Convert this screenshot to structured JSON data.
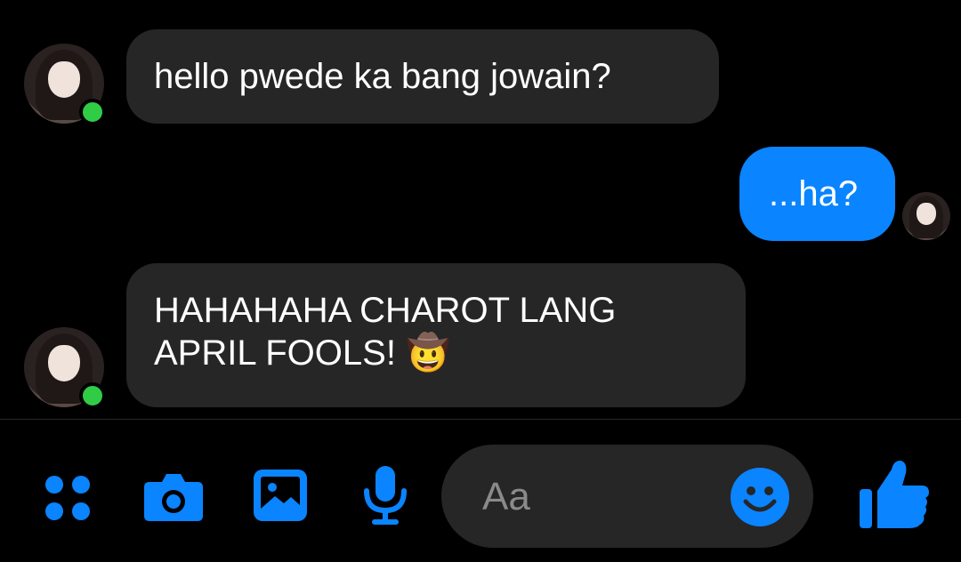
{
  "messages": [
    {
      "direction": "incoming",
      "text": "hello pwede ka bang jowain?"
    },
    {
      "direction": "outgoing",
      "text": "...ha?"
    },
    {
      "direction": "incoming",
      "line1": "HAHAHAHA CHAROT LANG",
      "line2": "APRIL FOOLS! ",
      "emoji": "🤠"
    }
  ],
  "composer": {
    "placeholder": "Aa"
  },
  "toolbar": {
    "icons": [
      "apps-icon",
      "camera-icon",
      "gallery-icon",
      "microphone-icon",
      "emoji-icon",
      "thumbs-up-icon"
    ]
  },
  "colors": {
    "accent": "#0a84ff",
    "incoming_bubble": "#262626",
    "online": "#31cc46",
    "background": "#000000"
  }
}
